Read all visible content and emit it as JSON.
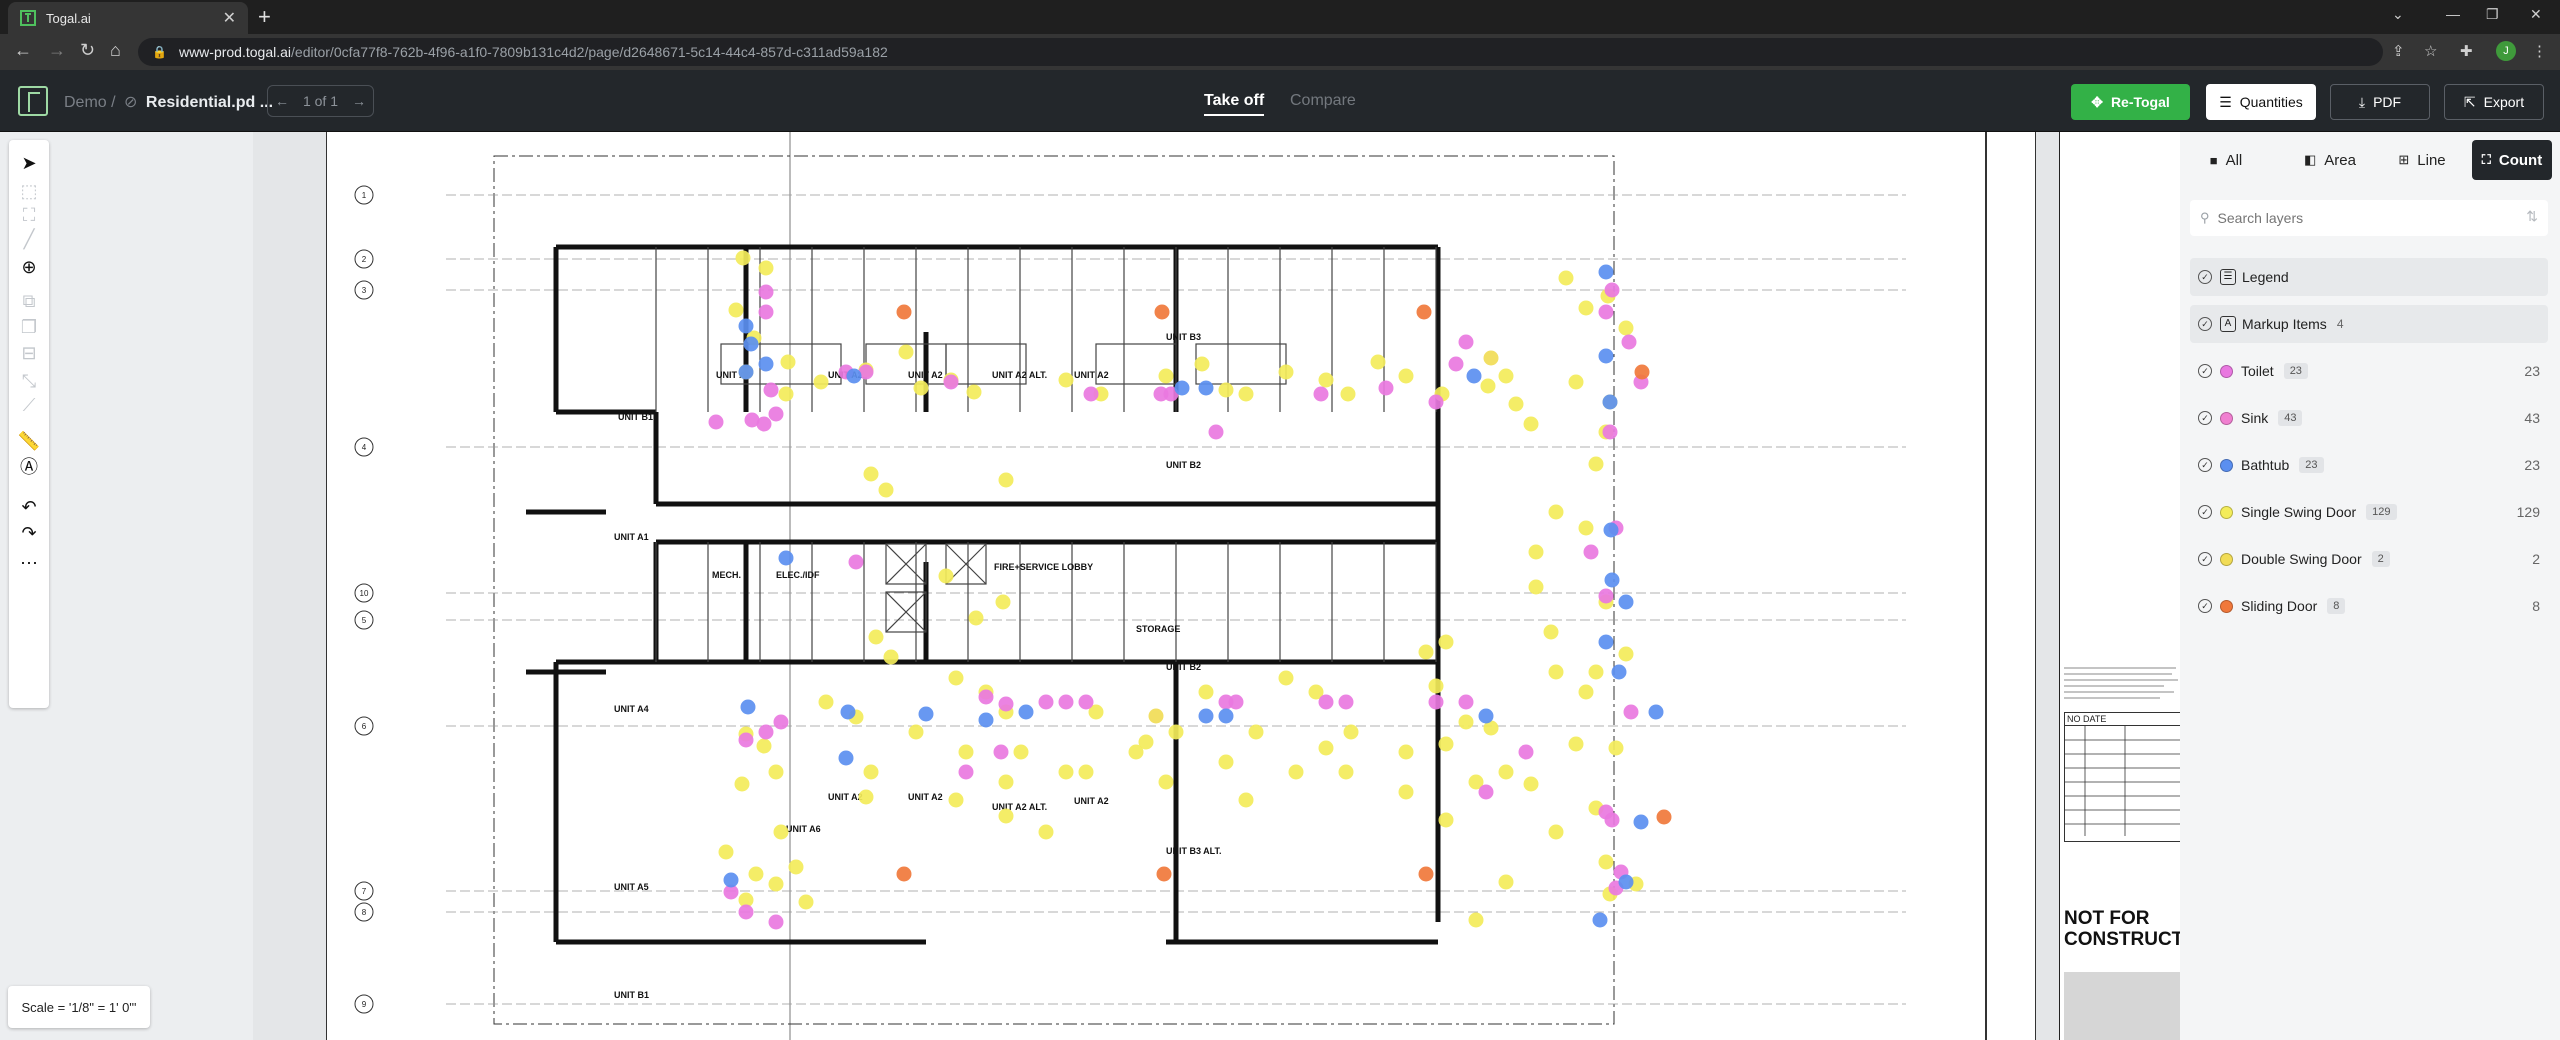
{
  "browser": {
    "tab_title": "Togal.ai",
    "url_host": "www-prod.togal.ai",
    "url_path": "/editor/0cfa77f8-762b-4f96-a1f0-7809b131c4d2/page/d2648671-5c14-44c4-857d-c311ad59a182",
    "profile_initial": "J"
  },
  "header": {
    "breadcrumb_root": "Demo /",
    "document_name": "Residential.pd ...",
    "page_indicator": "1 of 1",
    "tabs": [
      {
        "label": "Take off",
        "active": true
      },
      {
        "label": "Compare",
        "active": false
      }
    ],
    "buttons": {
      "retogal": "Re-Togal",
      "quantities": "Quantities",
      "pdf": "PDF",
      "export": "Export"
    },
    "accent_color": "#33b147"
  },
  "tools": [
    {
      "name": "select-tool",
      "glyph": "➤",
      "enabled": true
    },
    {
      "name": "area-box-tool",
      "glyph": "⬚",
      "enabled": false
    },
    {
      "name": "crop-tool",
      "glyph": "⛶",
      "enabled": false
    },
    {
      "name": "line-tool",
      "glyph": "╱",
      "enabled": false
    },
    {
      "name": "count-tool",
      "glyph": "⊕",
      "enabled": true
    },
    {
      "name": "copy-tool",
      "glyph": "⧉",
      "enabled": false
    },
    {
      "name": "duplicate-tool",
      "glyph": "❐",
      "enabled": false
    },
    {
      "name": "merge-tool",
      "glyph": "⊟",
      "enabled": false
    },
    {
      "name": "path-tool",
      "glyph": "⤡",
      "enabled": false
    },
    {
      "name": "scale-line-tool",
      "glyph": "⟋",
      "enabled": false
    },
    {
      "name": "ruler-tool",
      "glyph": "📏",
      "enabled": true
    },
    {
      "name": "markup-tool",
      "glyph": "Ⓐ",
      "enabled": true
    },
    {
      "name": "undo-tool",
      "glyph": "↶",
      "enabled": true
    },
    {
      "name": "redo-tool",
      "glyph": "↷",
      "enabled": true
    },
    {
      "name": "more-tool",
      "glyph": "⋯",
      "enabled": true
    }
  ],
  "scale_label": "Scale = '1/8\" = 1' 0\"'",
  "sheet_side_text": {
    "not_for_construction": "NOT FOR CONSTRUCT",
    "table_header": "NO  DATE"
  },
  "plan": {
    "unit_labels": [
      "UNIT B1",
      "UNIT A3",
      "UNIT A2",
      "UNIT A2",
      "UNIT A2 ALT.",
      "UNIT A2",
      "UNIT B3",
      "UNIT B2",
      "UNIT A1",
      "MECH.",
      "ELEC./IDF",
      "FIRE+SERVICE LOBBY",
      "STORAGE",
      "UNIT B2",
      "UNIT A4",
      "UNIT A2",
      "UNIT A2",
      "UNIT A2 ALT.",
      "UNIT A2",
      "UNIT A6",
      "UNIT B3 ALT.",
      "UNIT A5",
      "UNIT B1"
    ],
    "grid_numbers": [
      "1",
      "2",
      "3",
      "4",
      "10",
      "5",
      "6",
      "7",
      "8",
      "9"
    ],
    "marker_colors": {
      "toilet": "#e978e0",
      "sink": "#f07fd0",
      "bathtub": "#5b8ff0",
      "single_swing_door": "#f3ec5a",
      "double_swing_door": "#f1dc56",
      "sliding_door": "#f0783b"
    }
  },
  "panel": {
    "filter_tabs": [
      {
        "label": "All",
        "icon": "square-icon",
        "active": false
      },
      {
        "label": "Area",
        "icon": "layers-icon",
        "active": false
      },
      {
        "label": "Line",
        "icon": "table-icon",
        "active": false
      },
      {
        "label": "Count",
        "icon": "count-icon",
        "active": true
      }
    ],
    "search_placeholder": "Search layers",
    "groups": [
      {
        "label": "Legend",
        "icon": "legend-icon"
      },
      {
        "label": "Markup Items",
        "count": "4",
        "icon": "markup-icon"
      }
    ],
    "layers": [
      {
        "label": "Toilet",
        "badge": "23",
        "count": "23",
        "color": "#e978e0"
      },
      {
        "label": "Sink",
        "badge": "43",
        "count": "43",
        "color": "#f07fd0"
      },
      {
        "label": "Bathtub",
        "badge": "23",
        "count": "23",
        "color": "#5b8ff0"
      },
      {
        "label": "Single Swing Door",
        "badge": "129",
        "count": "129",
        "color": "#f3ec5a"
      },
      {
        "label": "Double Swing Door",
        "badge": "2",
        "count": "2",
        "color": "#f1dc56"
      },
      {
        "label": "Sliding Door",
        "badge": "8",
        "count": "8",
        "color": "#f0783b"
      }
    ]
  }
}
